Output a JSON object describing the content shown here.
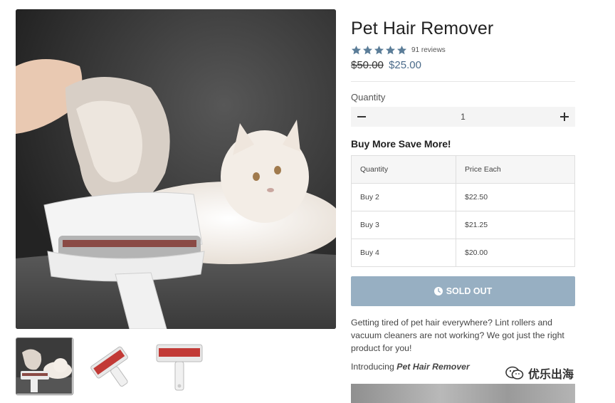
{
  "product": {
    "title": "Pet Hair Remover",
    "rating": 5,
    "reviews": "91 reviews",
    "price_old": "$50.00",
    "price_new": "$25.00"
  },
  "quantity": {
    "label": "Quantity",
    "value": "1"
  },
  "bulk": {
    "title": "Buy More Save More!",
    "headers": [
      "Quantity",
      "Price Each"
    ],
    "rows": [
      {
        "qty": "Buy 2",
        "price": "$22.50"
      },
      {
        "qty": "Buy 3",
        "price": "$21.25"
      },
      {
        "qty": "Buy 4",
        "price": "$20.00"
      }
    ]
  },
  "sold_out_label": "SOLD OUT",
  "description": "Getting tired of pet hair everywhere? Lint rollers and vacuum cleaners are not working? We got just the right product for you!",
  "intro": {
    "prefix": "Introducing ",
    "name": "Pet Hair Remover"
  },
  "watermark": "优乐出海",
  "colors": {
    "accent": "#4b6b8a",
    "star": "#5b7d98",
    "button": "#97afc2"
  },
  "icons": {
    "star": "star-icon",
    "minus": "minus-icon",
    "plus": "plus-icon",
    "clock": "clock-icon",
    "wechat": "wechat-icon"
  }
}
